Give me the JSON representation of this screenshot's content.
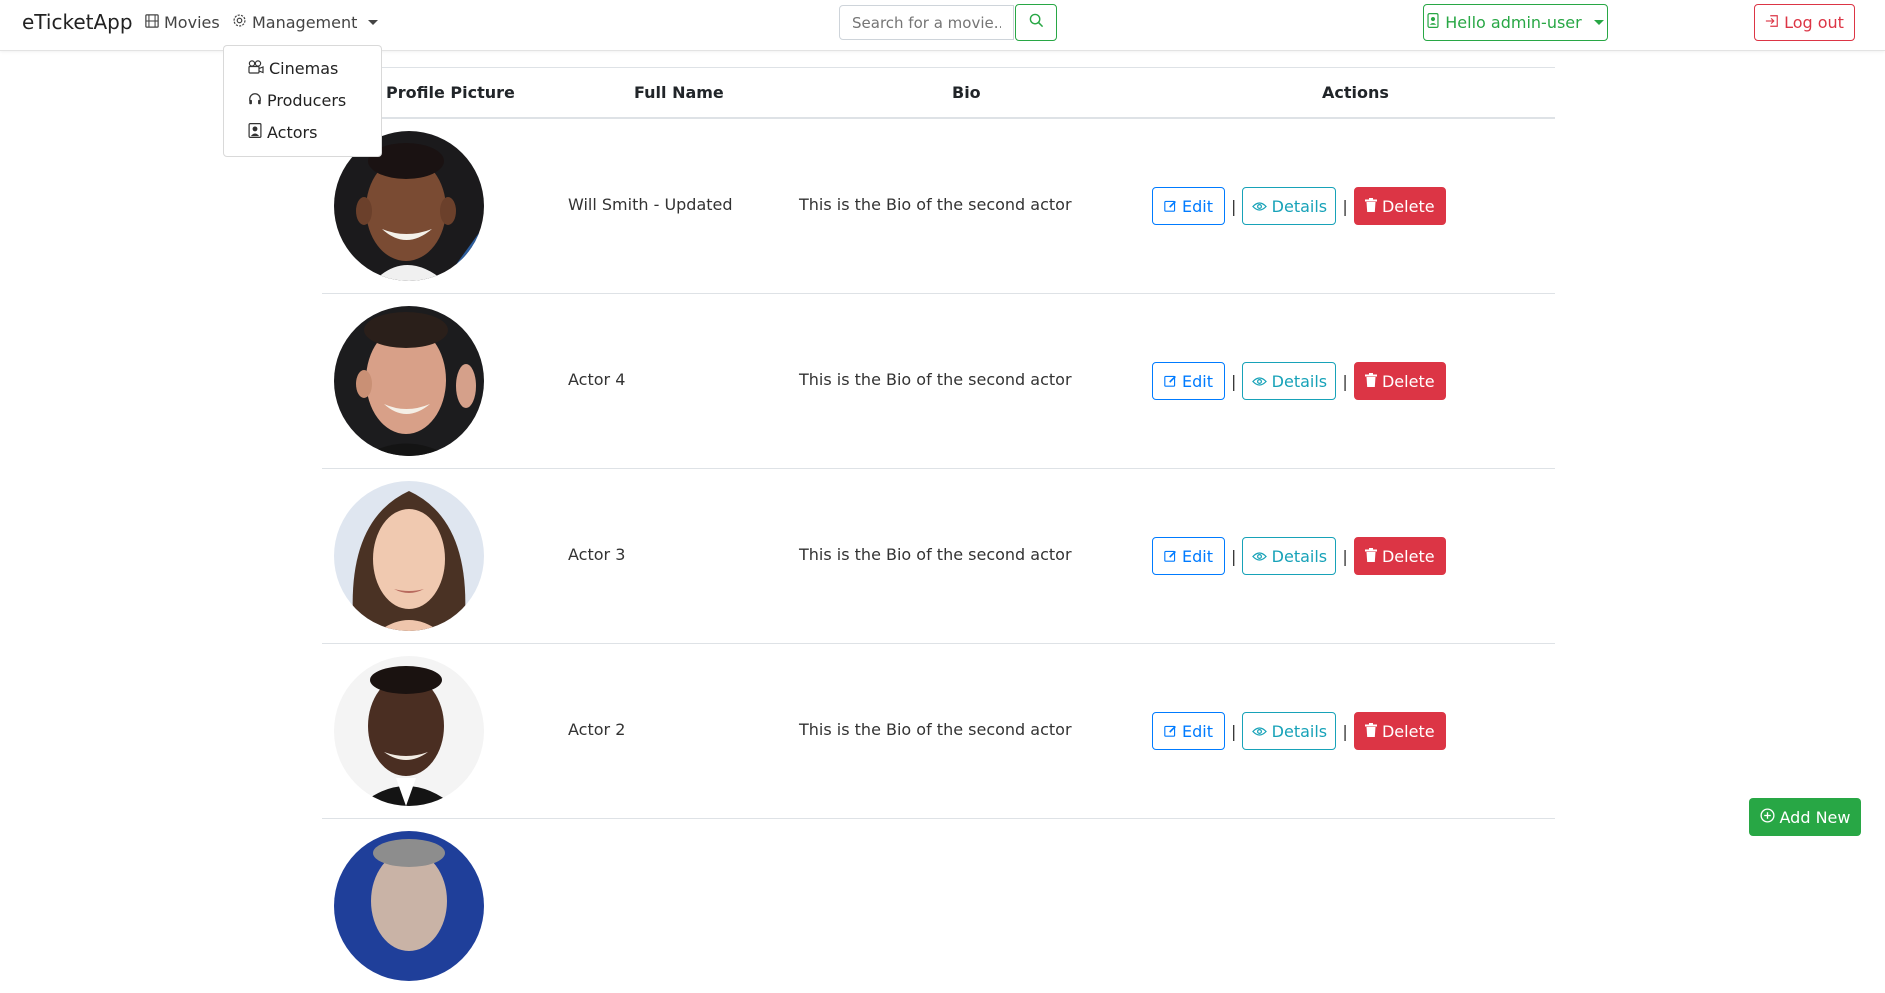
{
  "navbar": {
    "brand": "eTicketApp",
    "movies_label": "Movies",
    "management_label": "Management",
    "search_placeholder": "Search for a movie...",
    "user_label": "Hello admin-user",
    "logout_label": "Log out"
  },
  "dropdown": {
    "items": [
      {
        "label": "Cinemas",
        "icon": "cinema-icon"
      },
      {
        "label": "Producers",
        "icon": "headphones-icon"
      },
      {
        "label": "Actors",
        "icon": "person-badge-icon"
      }
    ]
  },
  "table": {
    "headers": {
      "picture": "Profile Picture",
      "name": "Full Name",
      "bio": "Bio",
      "actions": "Actions"
    },
    "rows": [
      {
        "name": "Will Smith - Updated",
        "bio": "This is the Bio of the second actor"
      },
      {
        "name": "Actor 4",
        "bio": "This is the Bio of the second actor"
      },
      {
        "name": "Actor 3",
        "bio": "This is the Bio of the second actor"
      },
      {
        "name": "Actor 2",
        "bio": "This is the Bio of the second actor"
      }
    ],
    "actions": {
      "edit": "Edit",
      "details": "Details",
      "delete": "Delete",
      "separator": "|"
    }
  },
  "add_new_label": "Add New",
  "colors": {
    "success": "#28a745",
    "danger": "#dc3545",
    "primary": "#007bff",
    "info": "#17a2b8"
  }
}
